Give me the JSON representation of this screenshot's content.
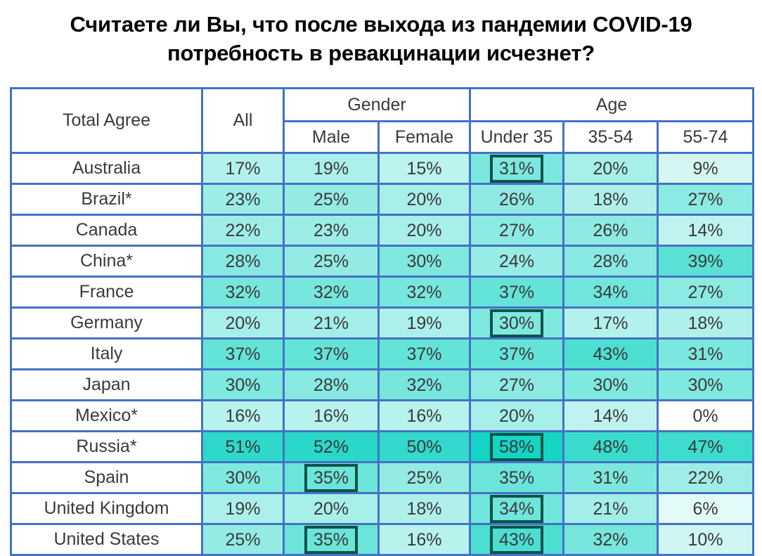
{
  "title": {
    "line1": "Считаете ли Вы, что после выхода из пандемии COVID-19",
    "line2": "потребность в ревакцинации исчезнет?"
  },
  "colors": {
    "border": "#4472C4",
    "highlight_box": "#0C5449",
    "scale_min": "#FFFFFF",
    "scale_max": "#14D4C4",
    "text": "#3A3A3A"
  },
  "table": {
    "corner_label": "Total Agree",
    "group_headers": [
      {
        "label": "",
        "span": 1
      },
      {
        "label": "Gender",
        "span": 2
      },
      {
        "label": "Age",
        "span": 3
      }
    ],
    "gender_group_label": "Gender",
    "age_group_label": "Age",
    "columns": [
      "All",
      "Male",
      "Female",
      "Under 35",
      "35-54",
      "55-74"
    ]
  },
  "chart_data": {
    "type": "heatmap",
    "title": "Считаете ли Вы, что после выхода из пандемии COVID-19 потребность в ревакцинации исчезнет?",
    "row_label": "Total Agree",
    "categories": [
      "All",
      "Male",
      "Female",
      "Under 35",
      "35-54",
      "55-74"
    ],
    "column_groups": [
      {
        "label": "Gender",
        "columns": [
          "Male",
          "Female"
        ]
      },
      {
        "label": "Age",
        "columns": [
          "Under 35",
          "35-54",
          "55-74"
        ]
      }
    ],
    "unit": "%",
    "value_range": [
      0,
      58
    ],
    "rows": [
      {
        "country": "Australia",
        "values": [
          17,
          19,
          15,
          31,
          20,
          9
        ],
        "highlight": [
          3
        ]
      },
      {
        "country": "Brazil*",
        "values": [
          23,
          25,
          20,
          26,
          18,
          27
        ],
        "highlight": []
      },
      {
        "country": "Canada",
        "values": [
          22,
          23,
          20,
          27,
          26,
          14
        ],
        "highlight": []
      },
      {
        "country": "China*",
        "values": [
          28,
          25,
          30,
          24,
          28,
          39
        ],
        "highlight": []
      },
      {
        "country": "France",
        "values": [
          32,
          32,
          32,
          37,
          34,
          27
        ],
        "highlight": []
      },
      {
        "country": "Germany",
        "values": [
          20,
          21,
          19,
          30,
          17,
          18
        ],
        "highlight": [
          3
        ]
      },
      {
        "country": "Italy",
        "values": [
          37,
          37,
          37,
          37,
          43,
          31
        ],
        "highlight": []
      },
      {
        "country": "Japan",
        "values": [
          30,
          28,
          32,
          27,
          30,
          30
        ],
        "highlight": []
      },
      {
        "country": "Mexico*",
        "values": [
          16,
          16,
          16,
          20,
          14,
          0
        ],
        "highlight": []
      },
      {
        "country": "Russia*",
        "values": [
          51,
          52,
          50,
          58,
          48,
          47
        ],
        "highlight": [
          3
        ]
      },
      {
        "country": "Spain",
        "values": [
          30,
          35,
          25,
          35,
          31,
          22
        ],
        "highlight": [
          1
        ]
      },
      {
        "country": "United Kingdom",
        "values": [
          19,
          20,
          18,
          34,
          21,
          6
        ],
        "highlight": [
          3
        ]
      },
      {
        "country": "United States",
        "values": [
          25,
          35,
          16,
          43,
          32,
          10
        ],
        "highlight": [
          1,
          3
        ]
      }
    ]
  }
}
